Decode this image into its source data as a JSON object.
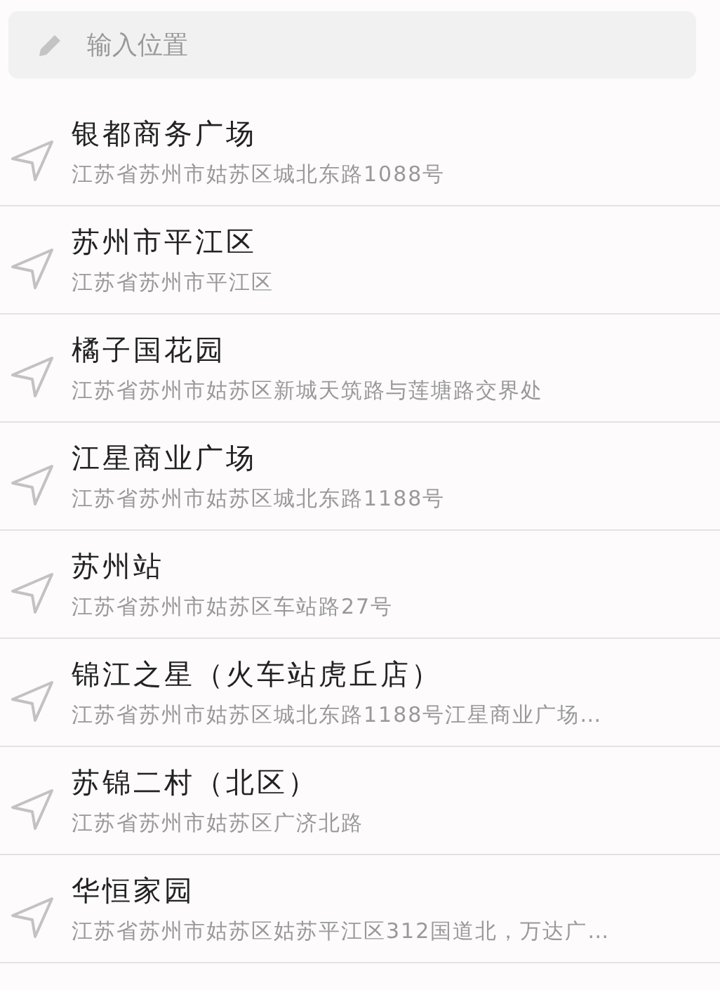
{
  "search": {
    "placeholder": "输入位置"
  },
  "places": [
    {
      "name": "银都商务广场",
      "address": "江苏省苏州市姑苏区城北东路1088号"
    },
    {
      "name": "苏州市平江区",
      "address": "江苏省苏州市平江区"
    },
    {
      "name": "橘子国花园",
      "address": "江苏省苏州市姑苏区新城天筑路与莲塘路交界处"
    },
    {
      "name": "江星商业广场",
      "address": "江苏省苏州市姑苏区城北东路1188号"
    },
    {
      "name": "苏州站",
      "address": "江苏省苏州市姑苏区车站路27号"
    },
    {
      "name": "锦江之星（火车站虎丘店）",
      "address": "江苏省苏州市姑苏区城北东路1188号江星商业广场…"
    },
    {
      "name": "苏锦二村（北区）",
      "address": "江苏省苏州市姑苏区广济北路"
    },
    {
      "name": "华恒家园",
      "address": "江苏省苏州市姑苏区姑苏平江区312国道北，万达广…"
    }
  ]
}
